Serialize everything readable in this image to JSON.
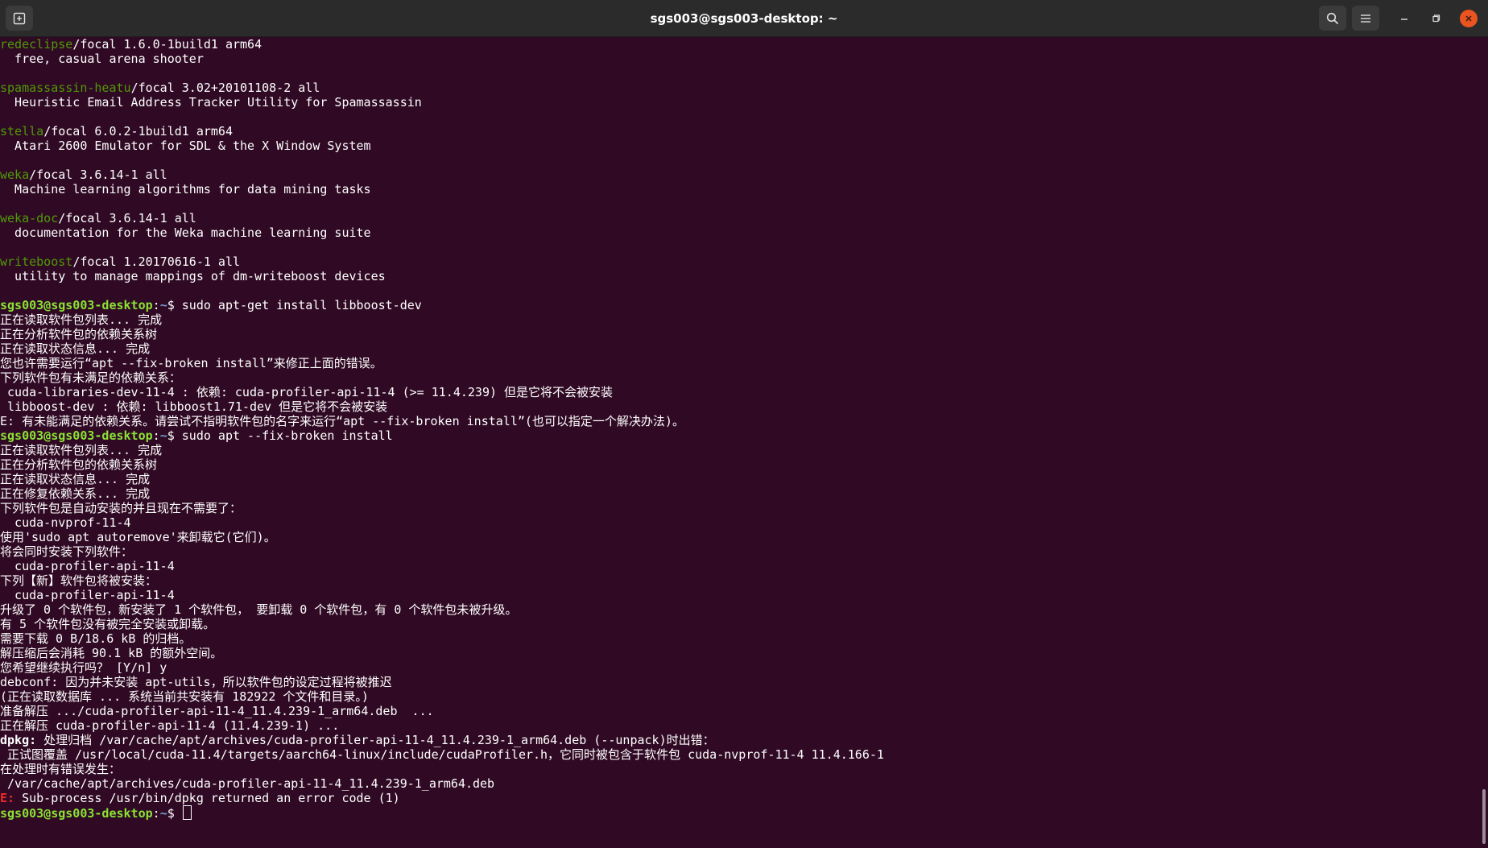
{
  "window": {
    "title": "sgs003@sgs003-desktop: ~"
  },
  "toolbar": {
    "new_tab_icon": "new-tab-icon",
    "search_icon": "search-icon",
    "menu_icon": "hamburger-menu-icon",
    "minimize_icon": "minimize-icon",
    "maximize_icon": "maximize-icon",
    "close_icon": "close-icon"
  },
  "colors": {
    "background": "#300a24",
    "text": "#ffffff",
    "package_name": "#4e9a06",
    "prompt_user": "#8ae234",
    "prompt_path": "#729fcf",
    "error": "#ef2929",
    "accent_close": "#e95420"
  },
  "terminal": {
    "lines": [
      [
        {
          "t": "redeclipse",
          "c": "pkg"
        },
        {
          "t": "/focal 1.6.0-1build1 arm64"
        }
      ],
      [
        {
          "t": "  free, casual arena shooter"
        }
      ],
      [],
      [
        {
          "t": "spamassassin-heatu",
          "c": "pkg"
        },
        {
          "t": "/focal 3.02+20101108-2 all"
        }
      ],
      [
        {
          "t": "  Heuristic Email Address Tracker Utility for Spamassassin"
        }
      ],
      [],
      [
        {
          "t": "stella",
          "c": "pkg"
        },
        {
          "t": "/focal 6.0.2-1build1 arm64"
        }
      ],
      [
        {
          "t": "  Atari 2600 Emulator for SDL & the X Window System"
        }
      ],
      [],
      [
        {
          "t": "weka",
          "c": "pkg"
        },
        {
          "t": "/focal 3.6.14-1 all"
        }
      ],
      [
        {
          "t": "  Machine learning algorithms for data mining tasks"
        }
      ],
      [],
      [
        {
          "t": "weka-doc",
          "c": "pkg"
        },
        {
          "t": "/focal 3.6.14-1 all"
        }
      ],
      [
        {
          "t": "  documentation for the Weka machine learning suite"
        }
      ],
      [],
      [
        {
          "t": "writeboost",
          "c": "pkg"
        },
        {
          "t": "/focal 1.20170616-1 all"
        }
      ],
      [
        {
          "t": "  utility to manage mappings of dm-writeboost devices"
        }
      ],
      [],
      [
        {
          "t": "sgs003@sgs003-desktop",
          "c": "user"
        },
        {
          "t": ":"
        },
        {
          "t": "~",
          "c": "path"
        },
        {
          "t": "$ sudo apt-get install libboost-dev"
        }
      ],
      [
        {
          "t": "正在读取软件包列表... 完成"
        }
      ],
      [
        {
          "t": "正在分析软件包的依赖关系树"
        }
      ],
      [
        {
          "t": "正在读取状态信息... 完成"
        }
      ],
      [
        {
          "t": "您也许需要运行“apt --fix-broken install”来修正上面的错误。"
        }
      ],
      [
        {
          "t": "下列软件包有未满足的依赖关系："
        }
      ],
      [
        {
          "t": " cuda-libraries-dev-11-4 : 依赖: cuda-profiler-api-11-4 (>= 11.4.239) 但是它将不会被安装"
        }
      ],
      [
        {
          "t": " libboost-dev : 依赖: libboost1.71-dev 但是它将不会被安装"
        }
      ],
      [
        {
          "t": "E: 有未能满足的依赖关系。请尝试不指明软件包的名字来运行“apt --fix-broken install”(也可以指定一个解决办法)。"
        }
      ],
      [
        {
          "t": "sgs003@sgs003-desktop",
          "c": "user"
        },
        {
          "t": ":"
        },
        {
          "t": "~",
          "c": "path"
        },
        {
          "t": "$ sudo apt --fix-broken install"
        }
      ],
      [
        {
          "t": "正在读取软件包列表... 完成"
        }
      ],
      [
        {
          "t": "正在分析软件包的依赖关系树"
        }
      ],
      [
        {
          "t": "正在读取状态信息... 完成"
        }
      ],
      [
        {
          "t": "正在修复依赖关系... 完成"
        }
      ],
      [
        {
          "t": "下列软件包是自动安装的并且现在不需要了："
        }
      ],
      [
        {
          "t": "  cuda-nvprof-11-4"
        }
      ],
      [
        {
          "t": "使用'sudo apt autoremove'来卸载它(它们)。"
        }
      ],
      [
        {
          "t": "将会同时安装下列软件："
        }
      ],
      [
        {
          "t": "  cuda-profiler-api-11-4"
        }
      ],
      [
        {
          "t": "下列【新】软件包将被安装："
        }
      ],
      [
        {
          "t": "  cuda-profiler-api-11-4"
        }
      ],
      [
        {
          "t": "升级了 0 个软件包，新安装了 1 个软件包， 要卸载 0 个软件包，有 0 个软件包未被升级。"
        }
      ],
      [
        {
          "t": "有 5 个软件包没有被完全安装或卸载。"
        }
      ],
      [
        {
          "t": "需要下载 0 B/18.6 kB 的归档。"
        }
      ],
      [
        {
          "t": "解压缩后会消耗 90.1 kB 的额外空间。"
        }
      ],
      [
        {
          "t": "您希望继续执行吗？ [Y/n] y"
        }
      ],
      [
        {
          "t": "debconf: 因为并未安装 apt-utils，所以软件包的设定过程将被推迟"
        }
      ],
      [
        {
          "t": "(正在读取数据库 ... 系统当前共安装有 182922 个文件和目录。)"
        }
      ],
      [
        {
          "t": "准备解压 .../cuda-profiler-api-11-4_11.4.239-1_arm64.deb  ..."
        }
      ],
      [
        {
          "t": "正在解压 cuda-profiler-api-11-4 (11.4.239-1) ..."
        }
      ],
      [
        {
          "t": "dpkg:",
          "c": "bold"
        },
        {
          "t": " 处理归档 /var/cache/apt/archives/cuda-profiler-api-11-4_11.4.239-1_arm64.deb (--unpack)时出错："
        }
      ],
      [
        {
          "t": " 正试图覆盖 /usr/local/cuda-11.4/targets/aarch64-linux/include/cudaProfiler.h，它同时被包含于软件包 cuda-nvprof-11-4 11.4.166-1"
        }
      ],
      [
        {
          "t": "在处理时有错误发生："
        }
      ],
      [
        {
          "t": " /var/cache/apt/archives/cuda-profiler-api-11-4_11.4.239-1_arm64.deb"
        }
      ],
      [
        {
          "t": "E:",
          "c": "err"
        },
        {
          "t": " Sub-process /usr/bin/dpkg returned an error code (1)"
        }
      ],
      [
        {
          "t": "sgs003@sgs003-desktop",
          "c": "user"
        },
        {
          "t": ":"
        },
        {
          "t": "~",
          "c": "path"
        },
        {
          "t": "$ "
        }
      ]
    ]
  }
}
